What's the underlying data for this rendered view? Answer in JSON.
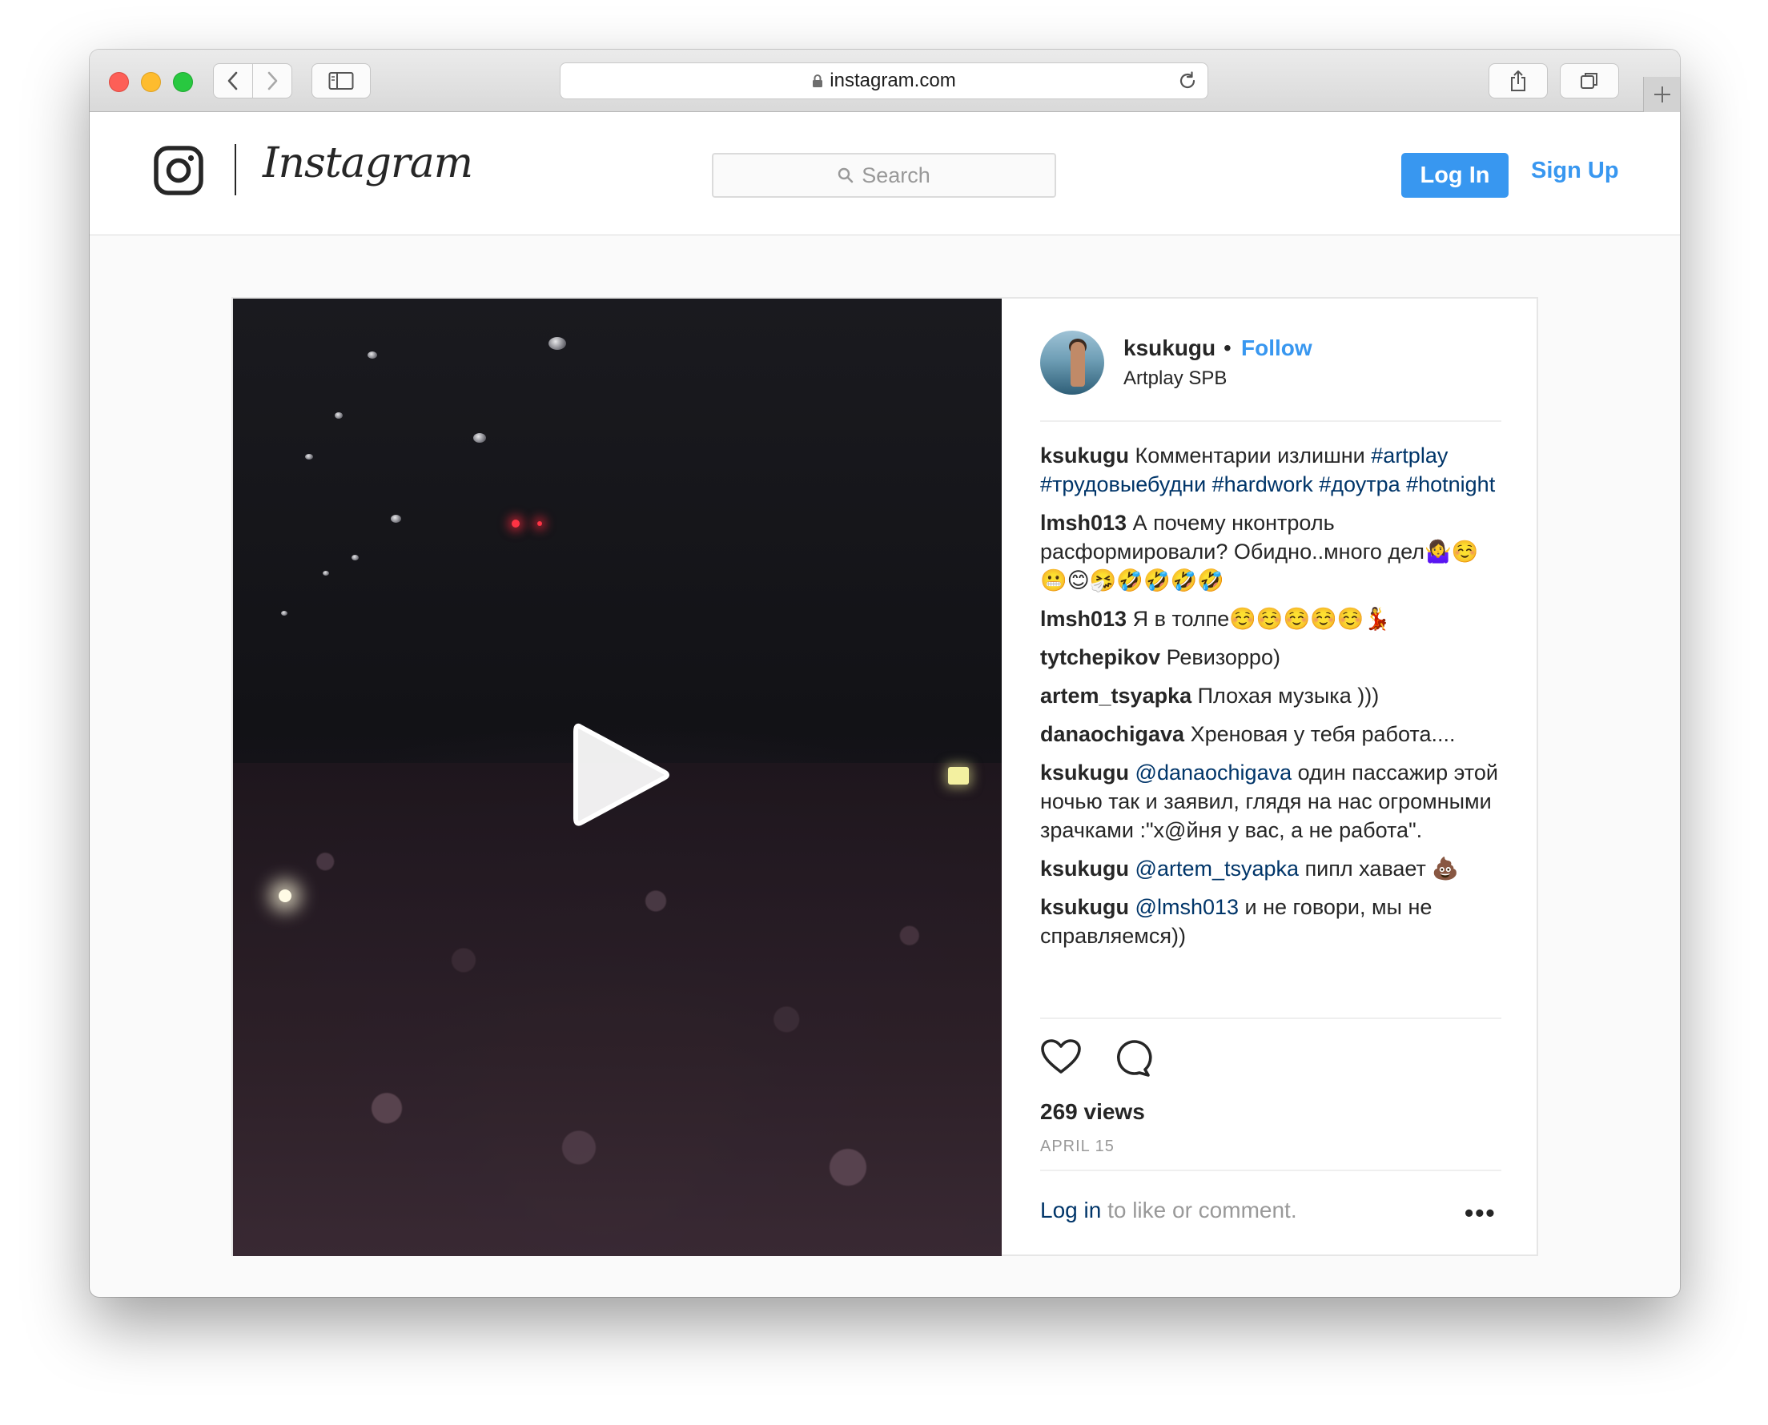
{
  "browser": {
    "url": "instagram.com"
  },
  "header": {
    "wordmark": "Instagram",
    "search_placeholder": "Search",
    "login_label": "Log In",
    "signup_label": "Sign Up",
    "accent_color": "#3897f0"
  },
  "post": {
    "username": "ksukugu",
    "separator": "•",
    "follow_label": "Follow",
    "location": "Artplay SPB",
    "comments": [
      {
        "user": "ksukugu",
        "text": "Комментарии излишни",
        "tags": "#artplay #трудовыебудни #hardwork #доутра #hotnight"
      },
      {
        "user": "lmsh013",
        "text": "А почему нконтроль расформировали? Обидно..много дел🤷‍♀️☺️😬😊🤧🤣🤣🤣🤣",
        "tags": ""
      },
      {
        "user": "lmsh013",
        "text": "Я в толпе☺️☺️☺️☺️☺️💃",
        "tags": ""
      },
      {
        "user": "tytchepikov",
        "text": "Ревизорро)",
        "tags": ""
      },
      {
        "user": "artem_tsyapka",
        "text": "Плохая музыка )))",
        "tags": ""
      },
      {
        "user": "danaochigava",
        "text": "Хреновая у тебя работа....",
        "tags": ""
      },
      {
        "user": "ksukugu",
        "mention": "@danaochigava",
        "text": "один пассажир этой ночью так и заявил, глядя на нас огромными зрачками :\"х@йня у вас, а не работа\"."
      },
      {
        "user": "ksukugu",
        "mention": "@artem_tsyapka",
        "text": "пипл хавает 💩"
      },
      {
        "user": "ksukugu",
        "mention": "@lmsh013",
        "text": "и не говори, мы не справляемся))"
      }
    ],
    "views": "269 views",
    "date": "APRIL 15",
    "footer_link": "Log in",
    "footer_text": " to like or comment.",
    "more": "•••"
  }
}
